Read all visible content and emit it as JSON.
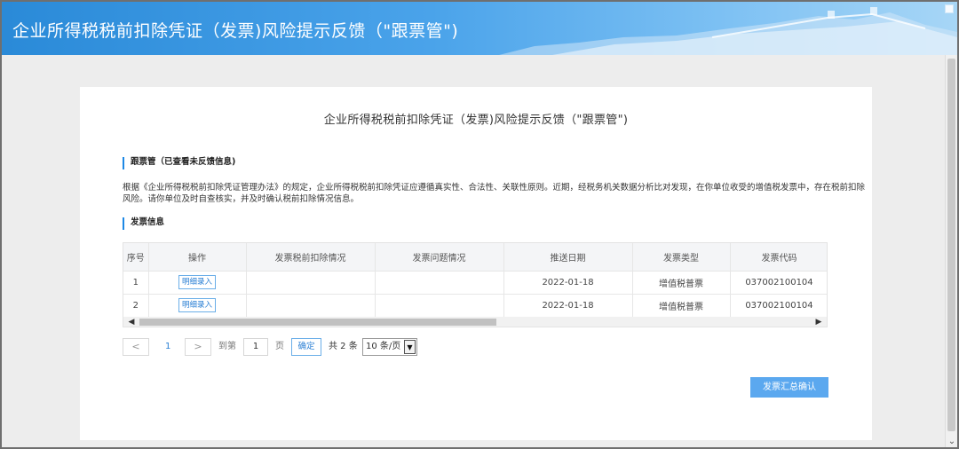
{
  "header": {
    "title": "企业所得税税前扣除凭证（发票)风险提示反馈（\"跟票管\")"
  },
  "card": {
    "title": "企业所得税税前扣除凭证（发票)风险提示反馈（\"跟票管\")",
    "section1": "跟票管（已查看未反馈信息)",
    "description": "根据《企业所得税税前扣除凭证管理办法》的规定，企业所得税税前扣除凭证应遵循真实性、合法性、关联性原则。近期，经税务机关数据分析比对发现，在你单位收受的增值税发票中，存在税前扣除风险。请你单位及时自查核实，并及时确认税前扣除情况信息。",
    "section2": "发票信息"
  },
  "table": {
    "columns": [
      "序号",
      "操作",
      "发票税前扣除情况",
      "发票问题情况",
      "推送日期",
      "发票类型",
      "发票代码"
    ],
    "rows": [
      {
        "index": "1",
        "action": "明细录入",
        "deduction": "",
        "issue": "",
        "date": "2022-01-18",
        "type": "增值税普票",
        "code": "037002100104"
      },
      {
        "index": "2",
        "action": "明细录入",
        "deduction": "",
        "issue": "",
        "date": "2022-01-18",
        "type": "增值税普票",
        "code": "037002100104"
      }
    ]
  },
  "pager": {
    "prev": "<",
    "current_page": "1",
    "next": ">",
    "goto_label": "到第",
    "goto_value": "1",
    "page_unit": "页",
    "confirm": "确定",
    "total": "共 2 条",
    "page_size": "10 条/页"
  },
  "actions": {
    "summary_confirm": "发票汇总确认"
  },
  "colors": {
    "accent": "#1e88e5",
    "button": "#5ba8ef"
  }
}
